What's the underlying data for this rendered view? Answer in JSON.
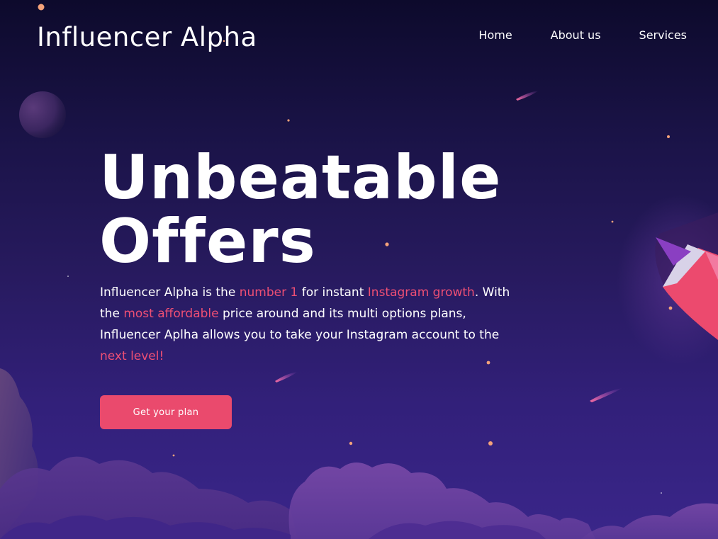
{
  "brand": {
    "name": "Influencer Alpha"
  },
  "nav": {
    "items": [
      {
        "label": "Home"
      },
      {
        "label": "About us"
      },
      {
        "label": "Services"
      }
    ]
  },
  "hero": {
    "title_line1": "Unbeatable",
    "title_line2": "Offers",
    "description": {
      "p1": "Influencer Alpha is the ",
      "h1": "number 1",
      "p2": " for instant ",
      "h2": "Instagram growth",
      "p3": ". With the ",
      "h3": "most affordable",
      "p4": " price around and its multi options plans, Influencer Aplha allows you to take your Instagram account to the ",
      "h4": "next level!"
    },
    "cta_label": "Get your plan"
  },
  "colors": {
    "accent": "#ea4a6d",
    "highlight_text": "#ee4f74",
    "background_top": "#0d0a2c",
    "background_bottom": "#3a268a",
    "cloud": "#6b3d9e",
    "star": "#f4a27a"
  },
  "decorations": {
    "icons": [
      "planet-icon",
      "rocket-icon",
      "meteor-icon",
      "star-icon",
      "cloud-icon"
    ]
  }
}
